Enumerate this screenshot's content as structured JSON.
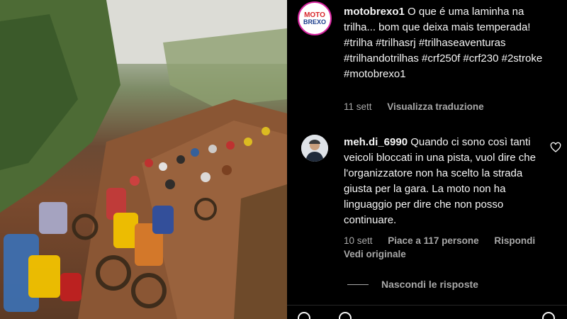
{
  "post": {
    "author": "motobrexo1",
    "logo": {
      "top": "MOTO",
      "bottom": "BREXO"
    },
    "caption": "O que é uma laminha na trilha... bom que deixa mais temperada! #trilha #trilhasrj #trilhaseaventuras #trilhandotrilhas #crf250f #crf230 #2stroke #motobrexo1",
    "time": "11 sett",
    "translate": "Visualizza traduzione"
  },
  "comment": {
    "author": "meh.di_6990",
    "text": "Quando ci sono così tanti veicoli bloccati in una pista, vuol dire che l'organizzatore non ha scelto la strada giusta per la gara. La moto non ha linguaggio per dire che non posso continuare.",
    "time": "10 sett",
    "likes": "Piace a 117 persone",
    "reply": "Rispondi",
    "see_original": "Vedi originale",
    "hide_replies": "Nascondi le risposte"
  },
  "colors": {
    "panel_bg": "#000000",
    "secondary_text": "#a8a8a8",
    "text": "#f5f5f5"
  }
}
